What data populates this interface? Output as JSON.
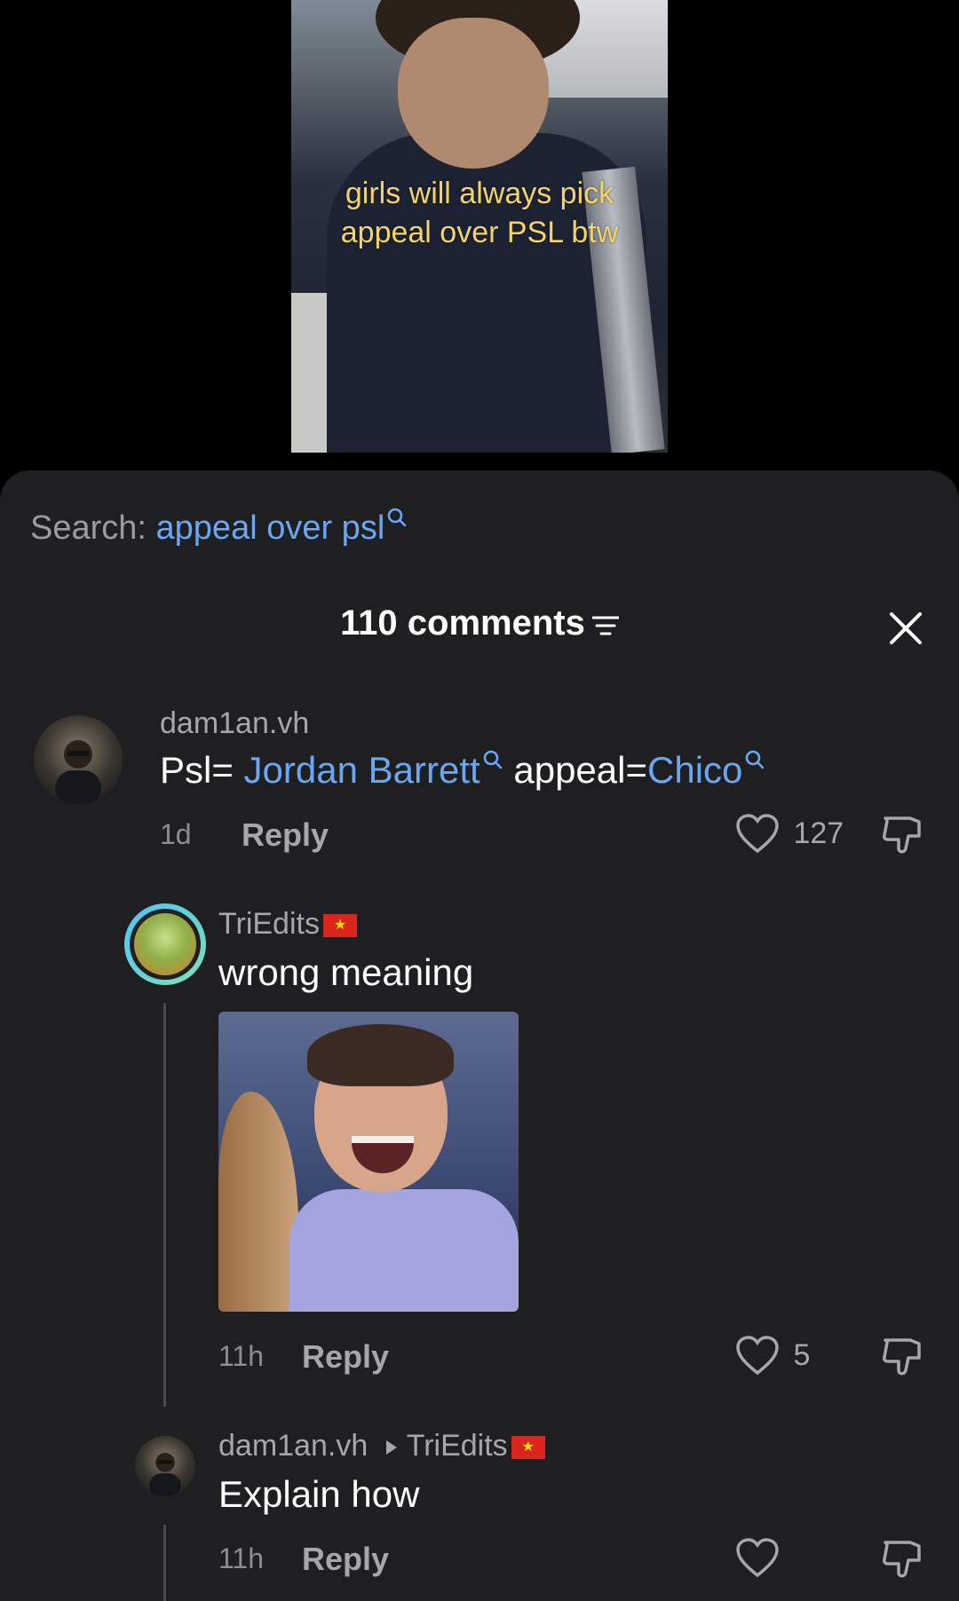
{
  "video": {
    "caption_line1": "girls will always pick",
    "caption_line2": "appeal over PSL btw"
  },
  "search": {
    "label": "Search:",
    "term": "appeal over psl"
  },
  "comments_header": {
    "title": "110 comments"
  },
  "comments": [
    {
      "username": "dam1an.vh",
      "text_before": "Psl=",
      "link1": "Jordan Barrett",
      "text_middle": "appeal=",
      "link2": "Chico",
      "time": "1d",
      "reply_label": "Reply",
      "likes": "127"
    },
    {
      "username": "TriEdits",
      "text": "wrong meaning",
      "time": "11h",
      "reply_label": "Reply",
      "likes": "5"
    },
    {
      "username": "dam1an.vh",
      "reply_to": "TriEdits",
      "text": "Explain how",
      "time": "11h",
      "reply_label": "Reply"
    }
  ],
  "icons": {
    "search": "magnifier-icon",
    "sort": "filter-lines-icon",
    "close": "x-icon",
    "like": "heart-outline-icon",
    "dislike": "thumbs-down-icon",
    "arrow": "triangle-right-icon",
    "flag": "vietnam-flag-icon"
  },
  "colors": {
    "link": "#6aa7f3",
    "sheet_bg": "#1f1f21",
    "caption": "#f2d46a"
  }
}
